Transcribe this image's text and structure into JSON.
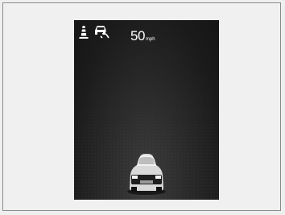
{
  "display": {
    "speed": {
      "value": "50",
      "unit": "mph"
    },
    "icons": [
      "lane-cone-icon",
      "driver-attention-icon",
      "lead-vehicle-icon"
    ],
    "colors": {
      "background": "#1b1b1b",
      "text": "#ffffff",
      "frame": "#8a8a8a"
    }
  }
}
